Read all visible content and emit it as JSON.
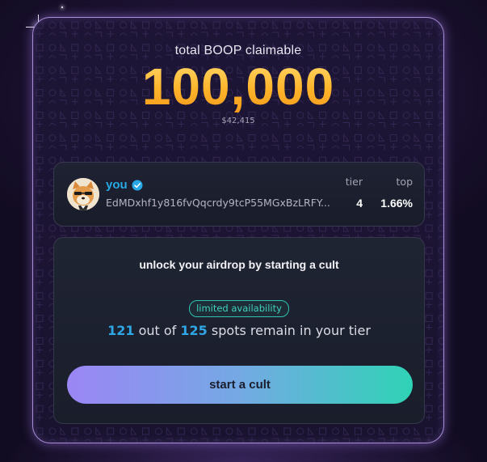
{
  "header": {
    "claim_label": "total BOOP claimable",
    "amount": "100,000",
    "usd_value": "$42,415"
  },
  "user": {
    "name": "you",
    "verified_icon": "verified-check-icon",
    "wallet": "EdMDxhf1y816fvQqcrdy9tcP55MGxBzLRFY...",
    "tier_label": "tier",
    "tier_value": "4",
    "top_label": "top",
    "top_value": "1.66%"
  },
  "cult": {
    "title": "unlock your airdrop by starting a cult",
    "badge": "limited availability",
    "spots_remaining": "121",
    "spots_mid": "out of",
    "spots_total": "125",
    "spots_suffix": "spots remain in your tier",
    "cta_label": "start a cult"
  },
  "colors": {
    "accent_blue": "#27a9e8",
    "amount_gold": "#ffb42a",
    "badge_teal": "#2ec4b0",
    "cta_gradient_start": "#9b86f5",
    "cta_gradient_end": "#2fd3b6",
    "card_border": "#a78ed6"
  }
}
